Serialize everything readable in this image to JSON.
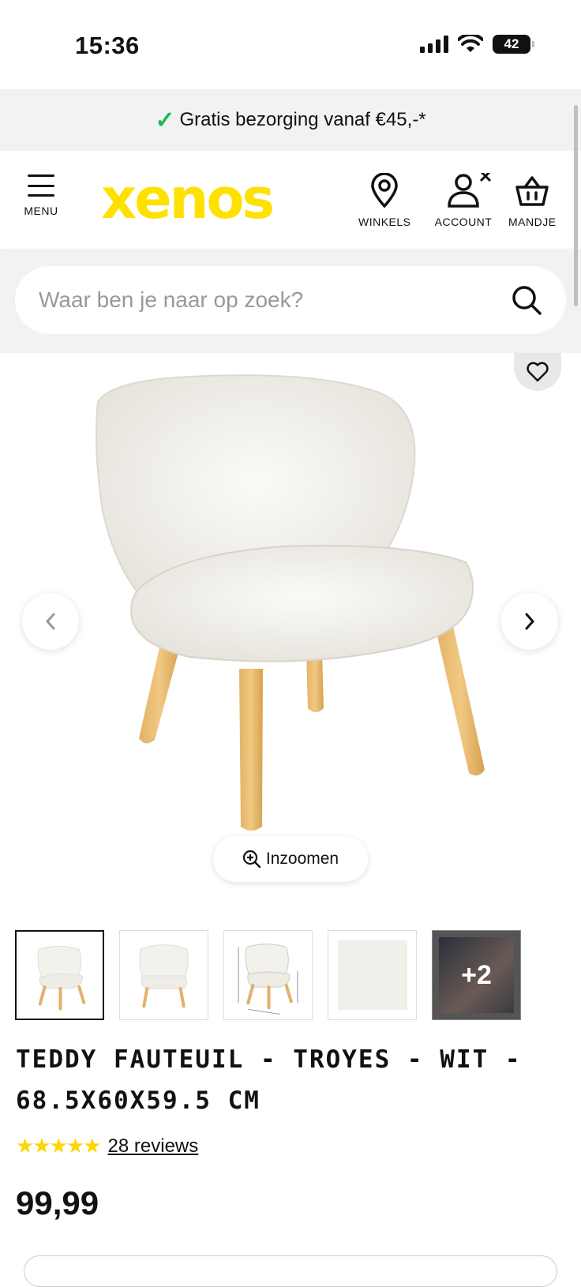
{
  "status": {
    "time": "15:36",
    "battery": "42"
  },
  "promo": {
    "text": "Gratis bezorging vanaf €45,-*"
  },
  "header": {
    "menu_label": "MENU",
    "logo": "xenos",
    "stores_label": "WINKELS",
    "account_label": "ACCOUNT",
    "cart_label": "MANDJE"
  },
  "search": {
    "placeholder": "Waar ben je naar op zoek?"
  },
  "gallery": {
    "zoom_label": "Inzoomen",
    "more_count": "+2"
  },
  "product": {
    "title": "TEDDY FAUTEUIL - TROYES - WIT - 68.5X60X59.5 CM",
    "rating": 5,
    "stars": "★★★★★",
    "reviews": "28 reviews",
    "price": "99,99"
  },
  "colors": {
    "brand": "#ffe100",
    "check": "#1db954",
    "star": "#ffd500"
  }
}
